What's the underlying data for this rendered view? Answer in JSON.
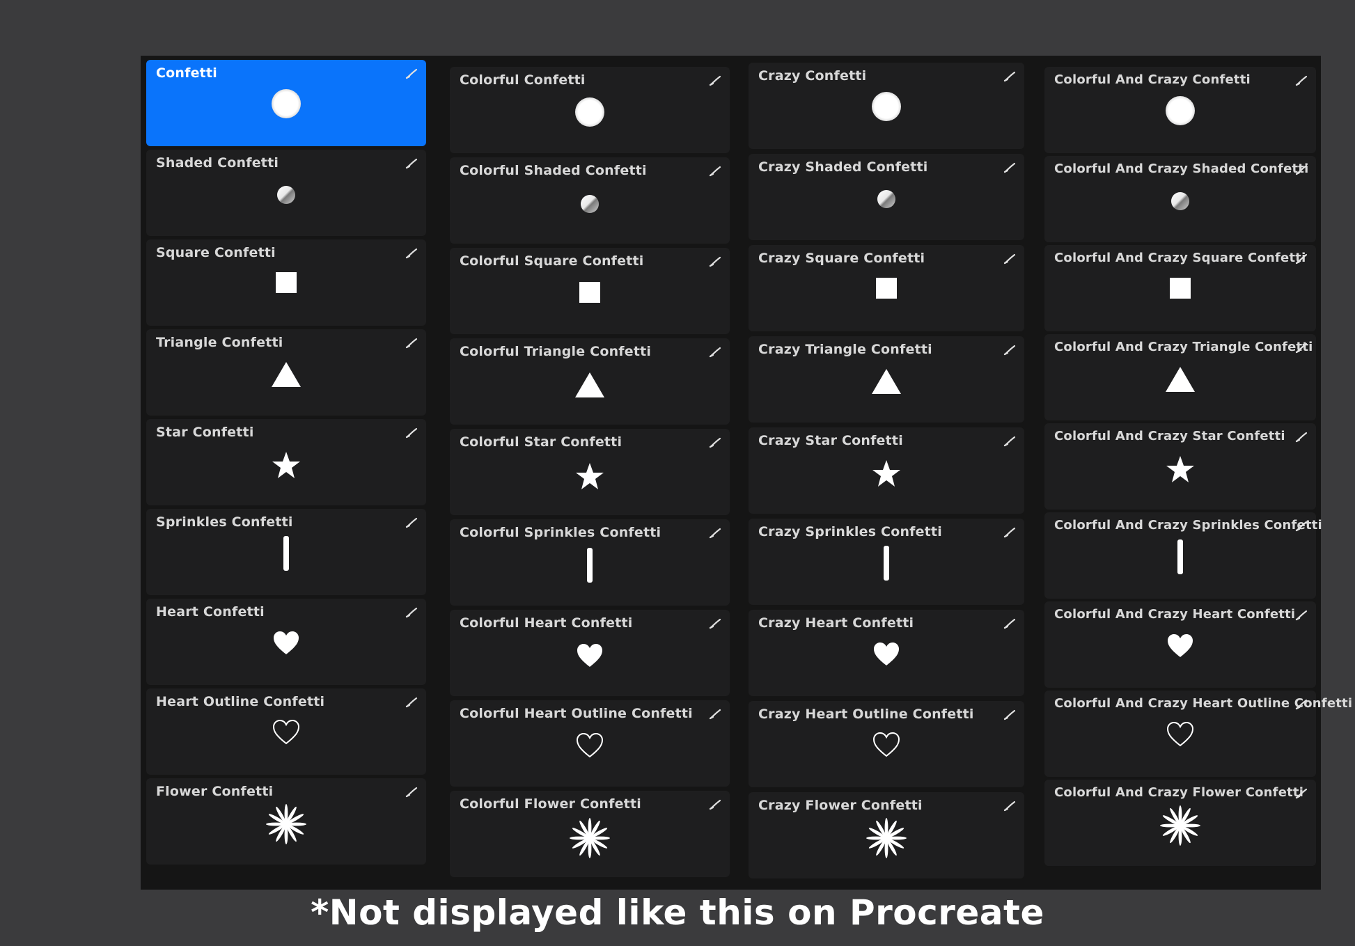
{
  "columns": [
    {
      "items": [
        {
          "label": "Confetti",
          "icon": "circle-icon",
          "selected": true
        },
        {
          "label": "Shaded Confetti",
          "icon": "shaded-sphere-icon"
        },
        {
          "label": "Square Confetti",
          "icon": "square-icon"
        },
        {
          "label": "Triangle Confetti",
          "icon": "triangle-icon"
        },
        {
          "label": "Star Confetti",
          "icon": "star-icon"
        },
        {
          "label": "Sprinkles Confetti",
          "icon": "sprinkle-icon"
        },
        {
          "label": "Heart Confetti",
          "icon": "heart-icon"
        },
        {
          "label": "Heart Outline Confetti",
          "icon": "heart-outline-icon"
        },
        {
          "label": "Flower Confetti",
          "icon": "flower-icon"
        }
      ]
    },
    {
      "items": [
        {
          "label": "Colorful Confetti",
          "icon": "circle-icon"
        },
        {
          "label": "Colorful Shaded Confetti",
          "icon": "shaded-sphere-icon"
        },
        {
          "label": "Colorful Square Confetti",
          "icon": "square-icon"
        },
        {
          "label": "Colorful Triangle Confetti",
          "icon": "triangle-icon"
        },
        {
          "label": "Colorful Star Confetti",
          "icon": "star-icon"
        },
        {
          "label": "Colorful Sprinkles Confetti",
          "icon": "sprinkle-icon"
        },
        {
          "label": "Colorful Heart Confetti",
          "icon": "heart-icon"
        },
        {
          "label": "Colorful Heart Outline Confetti",
          "icon": "heart-outline-icon"
        },
        {
          "label": "Colorful Flower Confetti",
          "icon": "flower-icon"
        }
      ]
    },
    {
      "items": [
        {
          "label": "Crazy Confetti",
          "icon": "circle-icon"
        },
        {
          "label": "Crazy Shaded Confetti",
          "icon": "shaded-sphere-icon"
        },
        {
          "label": "Crazy Square Confetti",
          "icon": "square-icon"
        },
        {
          "label": "Crazy Triangle Confetti",
          "icon": "triangle-icon"
        },
        {
          "label": "Crazy Star Confetti",
          "icon": "star-icon"
        },
        {
          "label": "Crazy Sprinkles Confetti",
          "icon": "sprinkle-icon"
        },
        {
          "label": "Crazy Heart Confetti",
          "icon": "heart-icon"
        },
        {
          "label": "Crazy Heart Outline Confetti",
          "icon": "heart-outline-icon"
        },
        {
          "label": "Crazy Flower Confetti",
          "icon": "flower-icon"
        }
      ]
    },
    {
      "items": [
        {
          "label": "Colorful And Crazy Confetti",
          "icon": "circle-icon"
        },
        {
          "label": "Colorful And Crazy Shaded Confetti",
          "icon": "shaded-sphere-icon"
        },
        {
          "label": "Colorful And Crazy Square Confetti",
          "icon": "square-icon"
        },
        {
          "label": "Colorful And Crazy Triangle Confetti",
          "icon": "triangle-icon"
        },
        {
          "label": "Colorful And Crazy Star Confetti",
          "icon": "star-icon"
        },
        {
          "label": "Colorful And Crazy Sprinkles Confetti",
          "icon": "sprinkle-icon"
        },
        {
          "label": "Colorful And Crazy Heart Confetti",
          "icon": "heart-icon"
        },
        {
          "label": "Colorful And Crazy Heart Outline Confetti",
          "icon": "heart-outline-icon"
        },
        {
          "label": "Colorful And Crazy Flower Confetti",
          "icon": "flower-icon"
        }
      ]
    }
  ],
  "footer": "*Not displayed like this on Procreate",
  "colors": {
    "selected": "#0a74fb",
    "card": "#1e1e1f",
    "panel": "#151515",
    "background": "#3b3b3d"
  }
}
